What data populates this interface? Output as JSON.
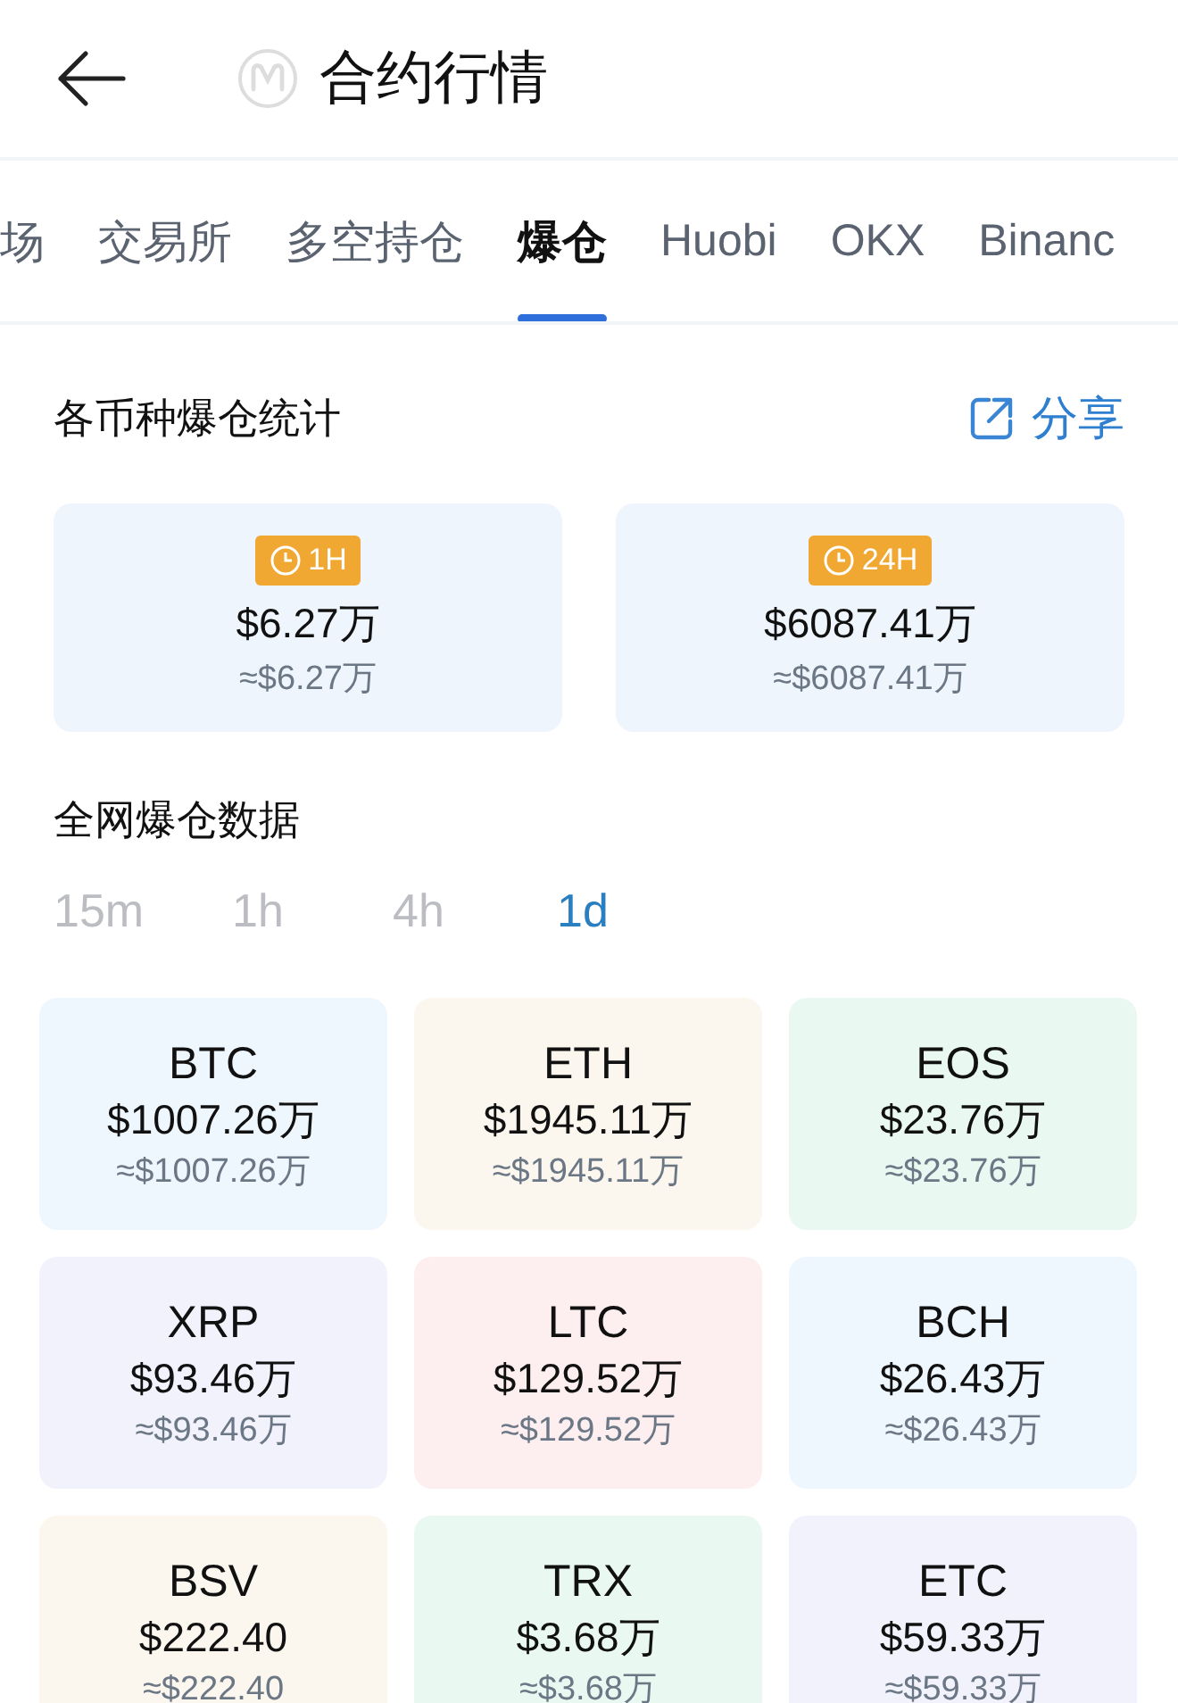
{
  "header": {
    "title": "合约行情"
  },
  "tabs": [
    {
      "label": "场",
      "selected": false
    },
    {
      "label": "交易所",
      "selected": false
    },
    {
      "label": "多空持仓",
      "selected": false
    },
    {
      "label": "爆仓",
      "selected": true
    },
    {
      "label": "Huobi",
      "selected": false
    },
    {
      "label": "OKX",
      "selected": false
    },
    {
      "label": "Binanc",
      "selected": false
    }
  ],
  "summary": {
    "title": "各币种爆仓统计",
    "share_label": "分享",
    "cards": [
      {
        "badge": "1H",
        "amount": "$6.27万",
        "approx": "≈$6.27万"
      },
      {
        "badge": "24H",
        "amount": "$6087.41万",
        "approx": "≈$6087.41万"
      }
    ]
  },
  "network": {
    "title": "全网爆仓数据",
    "periods": [
      {
        "label": "15m",
        "selected": false
      },
      {
        "label": "1h",
        "selected": false
      },
      {
        "label": "4h",
        "selected": false
      },
      {
        "label": "1d",
        "selected": true
      }
    ],
    "coins": [
      {
        "symbol": "BTC",
        "amount": "$1007.26万",
        "approx": "≈$1007.26万",
        "color": "#eef6fe"
      },
      {
        "symbol": "ETH",
        "amount": "$1945.11万",
        "approx": "≈$1945.11万",
        "color": "#fbf6ee"
      },
      {
        "symbol": "EOS",
        "amount": "$23.76万",
        "approx": "≈$23.76万",
        "color": "#e9f8f1"
      },
      {
        "symbol": "XRP",
        "amount": "$93.46万",
        "approx": "≈$93.46万",
        "color": "#f2f2fd"
      },
      {
        "symbol": "LTC",
        "amount": "$129.52万",
        "approx": "≈$129.52万",
        "color": "#fdeef0"
      },
      {
        "symbol": "BCH",
        "amount": "$26.43万",
        "approx": "≈$26.43万",
        "color": "#eef6fe"
      },
      {
        "symbol": "BSV",
        "amount": "$222.40",
        "approx": "≈$222.40",
        "color": "#fbf6ee"
      },
      {
        "symbol": "TRX",
        "amount": "$3.68万",
        "approx": "≈$3.68万",
        "color": "#e9f8f1"
      },
      {
        "symbol": "ETC",
        "amount": "$59.33万",
        "approx": "≈$59.33万",
        "color": "#f2f2fd"
      }
    ]
  }
}
